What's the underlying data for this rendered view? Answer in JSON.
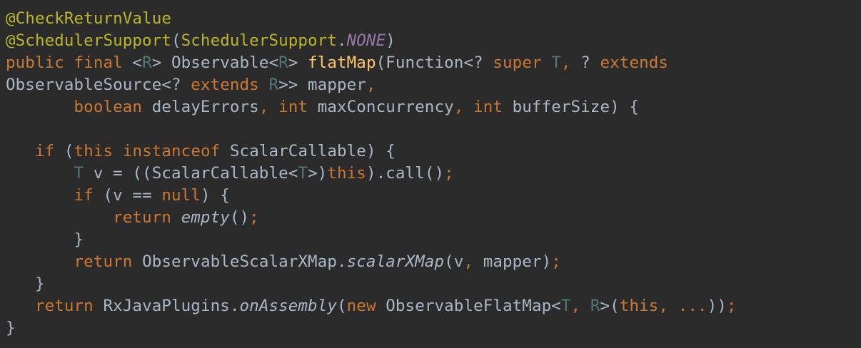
{
  "editor": {
    "background": "#2b2b2b",
    "theme_colors": {
      "plain": "#a9b7c6",
      "annotation": "#bbb529",
      "keyword": "#cc7832",
      "type_parameter": "#507874",
      "method_declaration": "#ffc66d",
      "constant": "#9876aa"
    },
    "lines": [
      {
        "indent": 0,
        "tokens": [
          {
            "t": "@CheckReturnValue",
            "k": "annotation"
          }
        ]
      },
      {
        "indent": 0,
        "tokens": [
          {
            "t": "@SchedulerSupport",
            "k": "annotation"
          },
          {
            "t": "(",
            "k": "plain"
          },
          {
            "t": "SchedulerSupport",
            "k": "annotation"
          },
          {
            "t": ".",
            "k": "plain"
          },
          {
            "t": "NONE",
            "k": "constant"
          },
          {
            "t": ")",
            "k": "plain"
          }
        ]
      },
      {
        "indent": 0,
        "tokens": [
          {
            "t": "public final ",
            "k": "keyword"
          },
          {
            "t": "<",
            "k": "plain"
          },
          {
            "t": "R",
            "k": "typeparam"
          },
          {
            "t": "> Observable<",
            "k": "plain"
          },
          {
            "t": "R",
            "k": "typeparam"
          },
          {
            "t": "> ",
            "k": "plain"
          },
          {
            "t": "flatMap",
            "k": "method"
          },
          {
            "t": "(Function<? ",
            "k": "plain"
          },
          {
            "t": "super ",
            "k": "keyword"
          },
          {
            "t": "T",
            "k": "typeparam"
          },
          {
            "t": ", ",
            "k": "keyword"
          },
          {
            "t": "? ",
            "k": "plain"
          },
          {
            "t": "extends",
            "k": "keyword"
          }
        ]
      },
      {
        "indent": 0,
        "tokens": [
          {
            "t": "ObservableSource<? ",
            "k": "plain"
          },
          {
            "t": "extends ",
            "k": "keyword"
          },
          {
            "t": "R",
            "k": "typeparam"
          },
          {
            "t": ">> mapper",
            "k": "plain"
          },
          {
            "t": ",",
            "k": "keyword"
          }
        ]
      },
      {
        "indent": 7,
        "tokens": [
          {
            "t": "boolean ",
            "k": "keyword"
          },
          {
            "t": "delayErrors",
            "k": "plain"
          },
          {
            "t": ", int ",
            "k": "keyword"
          },
          {
            "t": "maxConcurrency",
            "k": "plain"
          },
          {
            "t": ", int ",
            "k": "keyword"
          },
          {
            "t": "bufferSize) {",
            "k": "plain"
          }
        ]
      },
      {
        "indent": 0,
        "tokens": []
      },
      {
        "indent": 3,
        "tokens": [
          {
            "t": "if ",
            "k": "keyword"
          },
          {
            "t": "(",
            "k": "plain"
          },
          {
            "t": "this instanceof ",
            "k": "keyword"
          },
          {
            "t": "ScalarCallable) {",
            "k": "plain"
          }
        ]
      },
      {
        "indent": 7,
        "tokens": [
          {
            "t": "T ",
            "k": "typeparam"
          },
          {
            "t": "v = ((ScalarCallable<",
            "k": "plain"
          },
          {
            "t": "T",
            "k": "typeparam"
          },
          {
            "t": ">)",
            "k": "plain"
          },
          {
            "t": "this",
            "k": "keyword"
          },
          {
            "t": ").call()",
            "k": "plain"
          },
          {
            "t": ";",
            "k": "keyword"
          }
        ]
      },
      {
        "indent": 7,
        "tokens": [
          {
            "t": "if ",
            "k": "keyword"
          },
          {
            "t": "(v == ",
            "k": "plain"
          },
          {
            "t": "null",
            "k": "keyword"
          },
          {
            "t": ") {",
            "k": "plain"
          }
        ]
      },
      {
        "indent": 11,
        "tokens": [
          {
            "t": "return ",
            "k": "keyword"
          },
          {
            "t": "empty",
            "k": "static"
          },
          {
            "t": "()",
            "k": "plain"
          },
          {
            "t": ";",
            "k": "keyword"
          }
        ]
      },
      {
        "indent": 7,
        "tokens": [
          {
            "t": "}",
            "k": "plain"
          }
        ]
      },
      {
        "indent": 7,
        "tokens": [
          {
            "t": "return ",
            "k": "keyword"
          },
          {
            "t": "ObservableScalarXMap.",
            "k": "plain"
          },
          {
            "t": "scalarXMap",
            "k": "static"
          },
          {
            "t": "(v",
            "k": "plain"
          },
          {
            "t": ", ",
            "k": "keyword"
          },
          {
            "t": "mapper)",
            "k": "plain"
          },
          {
            "t": ";",
            "k": "keyword"
          }
        ]
      },
      {
        "indent": 3,
        "tokens": [
          {
            "t": "}",
            "k": "plain"
          }
        ]
      },
      {
        "indent": 3,
        "tokens": [
          {
            "t": "return ",
            "k": "keyword"
          },
          {
            "t": "RxJavaPlugins.",
            "k": "plain"
          },
          {
            "t": "onAssembly",
            "k": "static"
          },
          {
            "t": "(",
            "k": "plain"
          },
          {
            "t": "new ",
            "k": "keyword"
          },
          {
            "t": "ObservableFlatMap<",
            "k": "plain"
          },
          {
            "t": "T",
            "k": "typeparam"
          },
          {
            "t": ", ",
            "k": "keyword"
          },
          {
            "t": "R",
            "k": "typeparam"
          },
          {
            "t": ">(",
            "k": "plain"
          },
          {
            "t": "this",
            "k": "keyword"
          },
          {
            "t": ", ...",
            "k": "keyword"
          },
          {
            "t": "))",
            "k": "plain"
          },
          {
            "t": ";",
            "k": "keyword"
          }
        ]
      },
      {
        "indent": 0,
        "tokens": [
          {
            "t": "}",
            "k": "plain"
          }
        ]
      }
    ]
  }
}
